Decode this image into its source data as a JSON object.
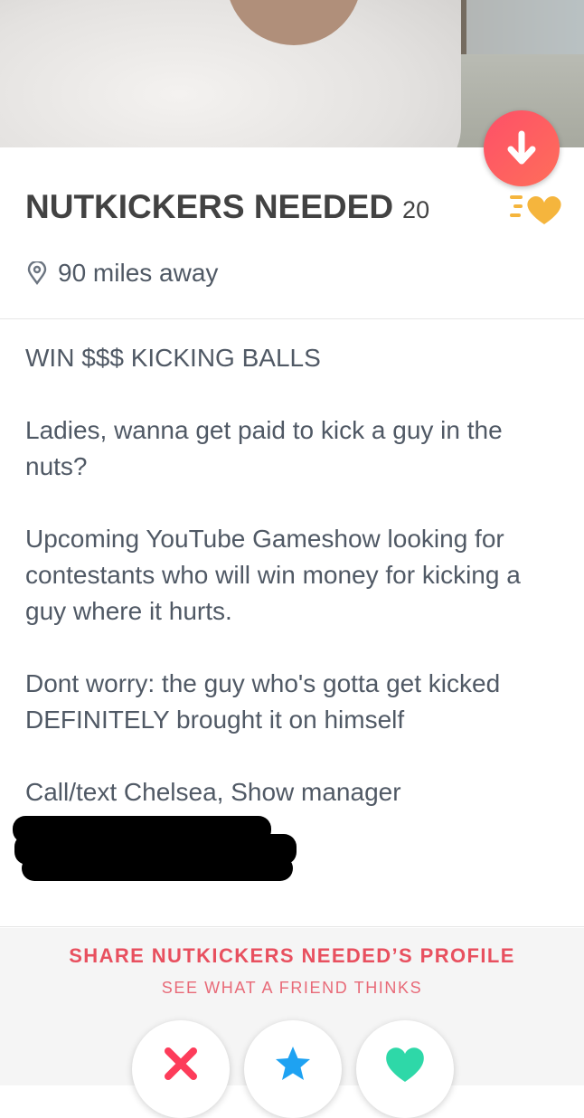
{
  "profile": {
    "name": "NUTKICKERS NEEDED",
    "age": "20",
    "distance": "90 miles away"
  },
  "bio": {
    "line_1": "WIN $$$ KICKING BALLS",
    "line_2": "Ladies, wanna get paid to kick a guy in the nuts?",
    "line_3": "Upcoming YouTube Gameshow looking for contestants who will win money for kicking a guy where it hurts.",
    "line_4": "Dont worry:  the guy who's gotta get kicked DEFINITELY brought it on himself",
    "line_5": "Call/text Chelsea, Show manager"
  },
  "share": {
    "title": "SHARE NUTKICKERS NEEDED’S PROFILE",
    "subtitle": "SEE WHAT A FRIEND THINKS"
  },
  "icons": {
    "collapse": "arrow-down-icon",
    "super_like_badge": "super-like-heart-icon",
    "location": "location-pin-icon",
    "nope": "x-icon",
    "super_like": "star-icon",
    "like": "heart-icon"
  },
  "colors": {
    "brand_gradient_start": "#fd5068",
    "brand_gradient_end": "#ff6e5a",
    "nope": "#fd3c5a",
    "super_like": "#1ea2f2",
    "like": "#2ed8a8",
    "gold": "#f5b53d"
  }
}
